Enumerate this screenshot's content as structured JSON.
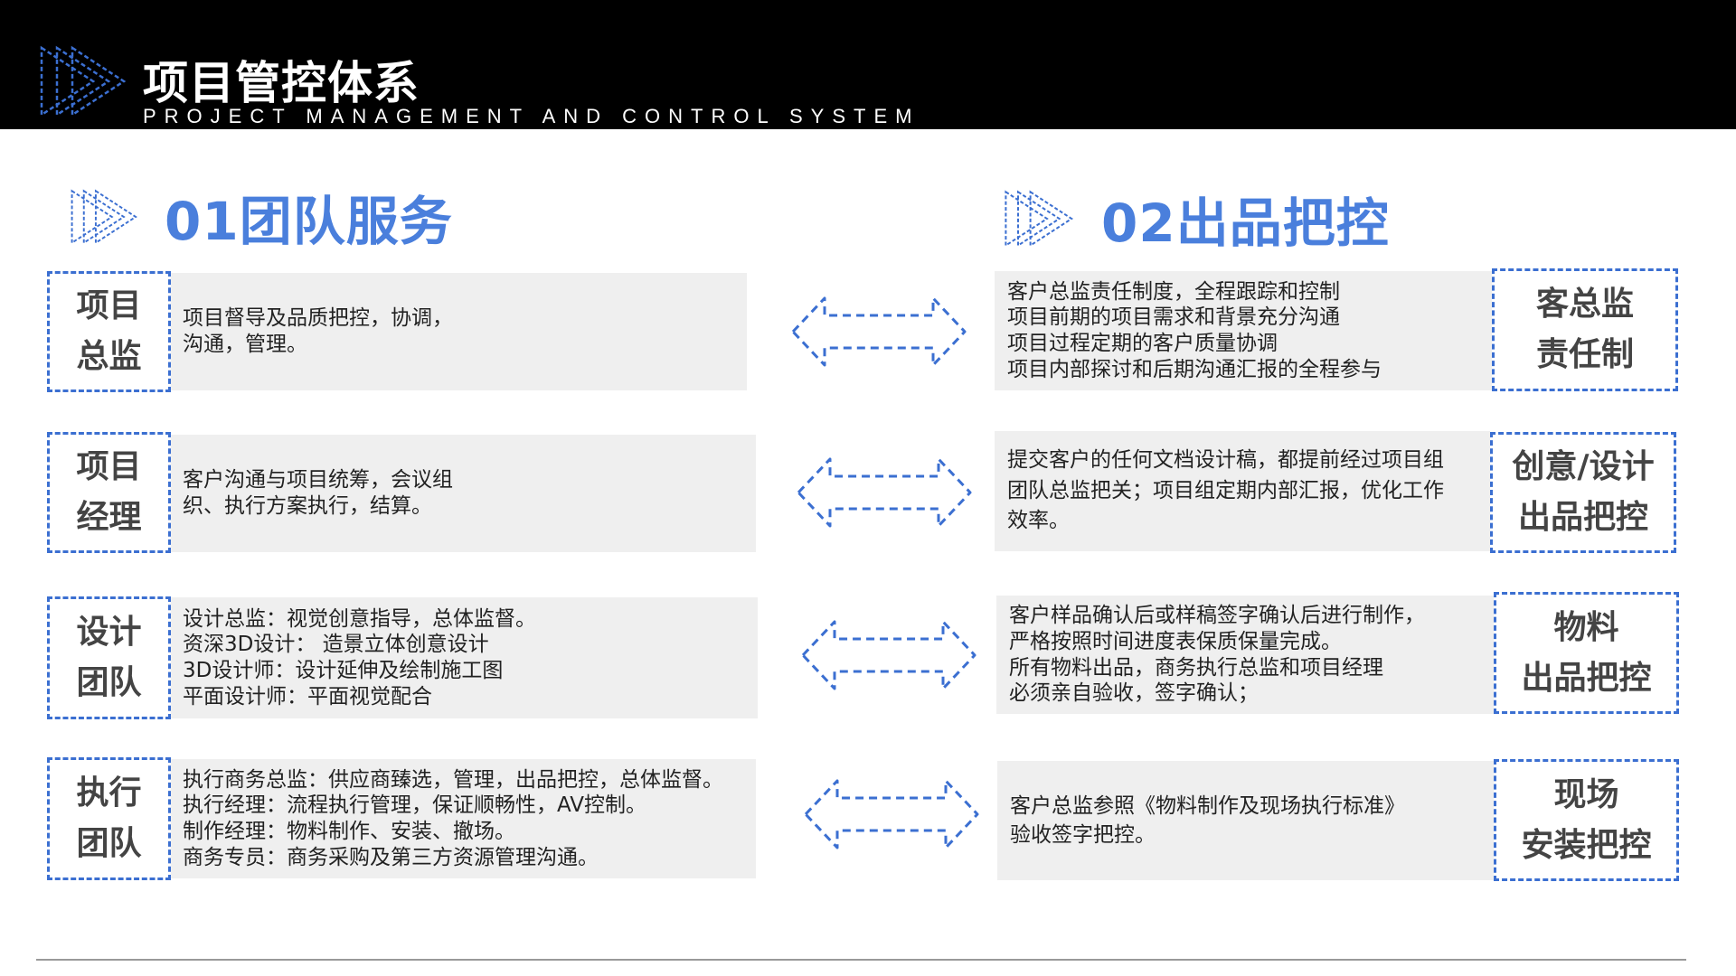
{
  "header": {
    "title": "项目管控体系",
    "subtitle": "PROJECT MANAGEMENT AND CONTROL SYSTEM"
  },
  "left": {
    "title": "01团队服务",
    "items": [
      {
        "label": "项目\n总监",
        "text": "项目督导及品质把控，协调，\n沟通，管理。"
      },
      {
        "label": "项目\n经理",
        "text": "客户沟通与项目统筹，会议组\n织、执行方案执行，结算。"
      },
      {
        "label": "设计\n团队",
        "text": "设计总监：视觉创意指导，总体监督。\n资深3D设计： 造景立体创意设计\n3D设计师：设计延伸及绘制施工图\n平面设计师：平面视觉配合"
      },
      {
        "label": "执行\n团队",
        "text": "执行商务总监：供应商臻选，管理，出品把控，总体监督。\n执行经理：流程执行管理，保证顺畅性，AV控制。\n制作经理：物料制作、安装、撤场。\n商务专员：商务采购及第三方资源管理沟通。"
      }
    ]
  },
  "right": {
    "title": "02出品把控",
    "items": [
      {
        "label": "客总监\n责任制",
        "text": "客户总监责任制度，全程跟踪和控制\n项目前期的项目需求和背景充分沟通\n项目过程定期的客户质量协调\n项目内部探讨和后期沟通汇报的全程参与"
      },
      {
        "label": "创意/设计\n出品把控",
        "text": "提交客户的任何文档设计稿，都提前经过项目组\n团队总监把关；项目组定期内部汇报，优化工作\n效率。"
      },
      {
        "label": "物料\n出品把控",
        "text": "客户样品确认后或样稿签字确认后进行制作，\n严格按照时间进度表保质保量完成。\n所有物料出品，商务执行总监和项目经理\n必须亲自验收，签字确认；"
      },
      {
        "label": "现场\n安装把控",
        "text": "客户总监参照《物料制作及现场执行标准》\n验收签字把控。"
      }
    ]
  },
  "colors": {
    "accent": "#4a7fdc",
    "dash": "#3b6fd1",
    "panel": "#efefef",
    "header_bg": "#000000"
  },
  "icons": {
    "logo": "triple-chevron-icon",
    "section": "triple-chevron-icon",
    "connector": "double-arrow-icon"
  }
}
